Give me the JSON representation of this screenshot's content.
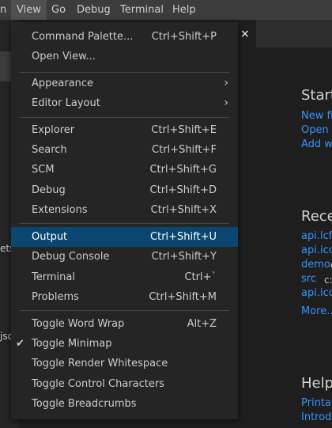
{
  "menubar": {
    "items": [
      {
        "label": "n"
      },
      {
        "label": "View"
      },
      {
        "label": "Go"
      },
      {
        "label": "Debug"
      },
      {
        "label": "Terminal"
      },
      {
        "label": "Help"
      }
    ]
  },
  "left": {
    "fragment1": "ets",
    "fragment2": "jsc"
  },
  "welcome": {
    "start_heading": "Start",
    "start_links": [
      "New fi",
      "Open f",
      "Add w"
    ],
    "recent_heading": "Rece",
    "recent_items": [
      {
        "name": "api.lcfc",
        "path": ""
      },
      {
        "name": "api.icoa",
        "path": ""
      },
      {
        "name": "demo",
        "path": "C"
      },
      {
        "name": "src",
        "path": "c:"
      },
      {
        "name": "api.icoa",
        "path": ""
      }
    ],
    "more": "More...",
    "help_heading": "Help",
    "help_links": [
      "Printab",
      "Introdu"
    ]
  },
  "view_menu": {
    "items": [
      {
        "label": "Command Palette...",
        "shortcut": "Ctrl+Shift+P"
      },
      {
        "label": "Open View...",
        "shortcut": ""
      },
      {
        "label": "Appearance",
        "shortcut": ""
      },
      {
        "label": "Editor Layout",
        "shortcut": ""
      },
      {
        "label": "Explorer",
        "shortcut": "Ctrl+Shift+E"
      },
      {
        "label": "Search",
        "shortcut": "Ctrl+Shift+F"
      },
      {
        "label": "SCM",
        "shortcut": "Ctrl+Shift+G"
      },
      {
        "label": "Debug",
        "shortcut": "Ctrl+Shift+D"
      },
      {
        "label": "Extensions",
        "shortcut": "Ctrl+Shift+X"
      },
      {
        "label": "Output",
        "shortcut": "Ctrl+Shift+U"
      },
      {
        "label": "Debug Console",
        "shortcut": "Ctrl+Shift+Y"
      },
      {
        "label": "Terminal",
        "shortcut": "Ctrl+`"
      },
      {
        "label": "Problems",
        "shortcut": "Ctrl+Shift+M"
      },
      {
        "label": "Toggle Word Wrap",
        "shortcut": "Alt+Z"
      },
      {
        "label": "Toggle Minimap",
        "shortcut": ""
      },
      {
        "label": "Toggle Render Whitespace",
        "shortcut": ""
      },
      {
        "label": "Toggle Control Characters",
        "shortcut": ""
      },
      {
        "label": "Toggle Breadcrumbs",
        "shortcut": ""
      }
    ],
    "highlighted": "Output",
    "checked": "Toggle Minimap"
  },
  "icons": {
    "close": "×",
    "chevron": "›",
    "check": "✔"
  },
  "colors": {
    "menubar_bg": "#3c3c3c",
    "menu_bg": "#252526",
    "highlight": "#094771",
    "link": "#3794ff",
    "editor_bg": "#1e1e1e"
  }
}
